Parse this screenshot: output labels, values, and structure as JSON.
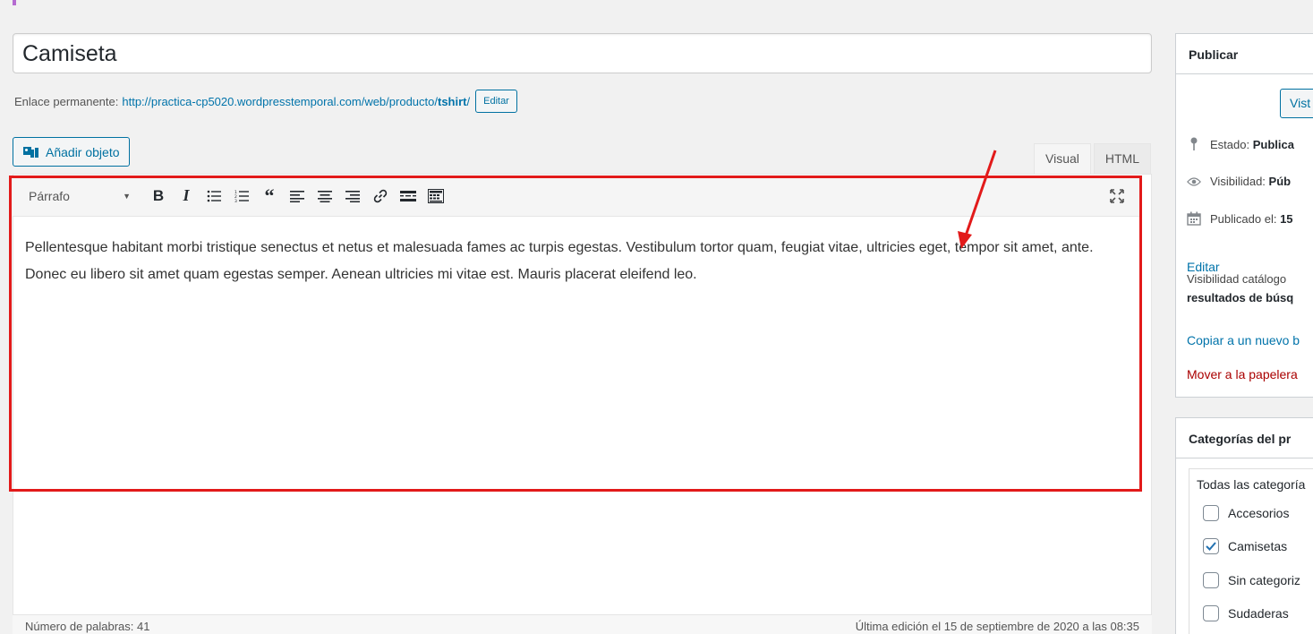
{
  "post": {
    "title": "Camiseta",
    "permalink_label": "Enlace permanente:",
    "permalink_base": "http://practica-cp5020.wordpresstemporal.com/web/producto/",
    "permalink_slug": "tshirt",
    "permalink_slug_end": "/",
    "permalink_edit": "Editar"
  },
  "editor": {
    "add_media": "Añadir objeto",
    "tabs": [
      "Visual",
      "HTML"
    ],
    "active_tab": "Visual",
    "format_select": "Párrafo",
    "toolbar_icons": [
      "bold-icon",
      "italic-icon",
      "bullet-list-icon",
      "numbered-list-icon",
      "blockquote-icon",
      "align-left-icon",
      "align-center-icon",
      "align-right-icon",
      "link-icon",
      "read-more-icon",
      "toolbar-toggle-icon",
      "fullscreen-icon"
    ],
    "content": "Pellentesque habitant morbi tristique senectus et netus et malesuada fames ac turpis egestas. Vestibulum tortor quam, feugiat vitae, ultricies eget, tempor sit amet, ante. Donec eu libero sit amet quam egestas semper. Aenean ultricies mi vitae est. Mauris placerat eleifend leo.",
    "word_count": "Número de palabras: 41",
    "last_edit": "Última edición el 15 de septiembre de 2020 a las 08:35"
  },
  "annotation": {
    "highlight_color": "#e21a1a"
  },
  "publish": {
    "title": "Publicar",
    "preview_button": "Vist",
    "status_label": "Estado:",
    "status_value": "Publica",
    "visibility_label": "Visibilidad:",
    "visibility_value": "Púb",
    "published_label": "Publicado el:",
    "published_value": "15",
    "edit_link": "Editar",
    "catalog_line1": "Visibilidad catálogo",
    "catalog_line2": "resultados de búsq",
    "copy_link": "Copiar a un nuevo b",
    "trash_link": "Mover a la papelera"
  },
  "categories": {
    "title": "Categorías del pr",
    "tab": "Todas las categoría",
    "items": [
      {
        "label": "Accesorios",
        "checked": false
      },
      {
        "label": "Camisetas",
        "checked": true
      },
      {
        "label": "Sin categoriz",
        "checked": false
      },
      {
        "label": "Sudaderas",
        "checked": false
      }
    ]
  },
  "colors": {
    "link": "#0073aa",
    "button_border": "#0071a1",
    "trash": "#a00"
  }
}
